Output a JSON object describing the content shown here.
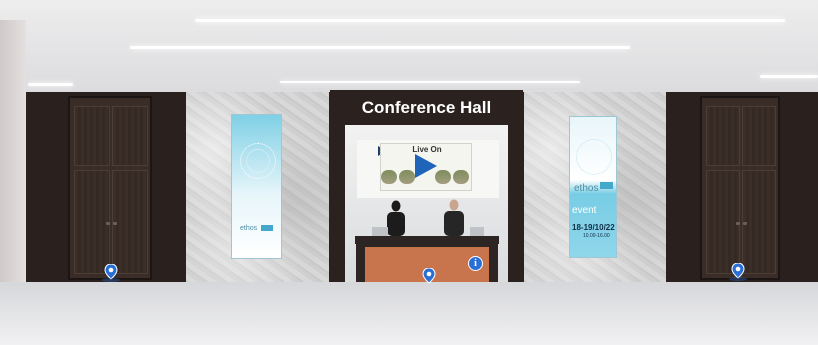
{
  "hall": {
    "title": "Conference Hall"
  },
  "screen": {
    "logo_text": "Live On"
  },
  "posters": {
    "left": {
      "brand": "ethos"
    },
    "right": {
      "brand": "ethos",
      "event_label": "event",
      "dates": "18-19/10/22",
      "time": "10.00-16.00"
    }
  },
  "hotspots": {
    "left_door": "location-pin-icon",
    "desk": "location-pin-icon",
    "info": "i",
    "right_door": "location-pin-icon"
  },
  "colors": {
    "wall_dark": "#2a201d",
    "desk_front": "#c8744c",
    "hotspot_blue": "#2a6fd6",
    "poster_cyan": "#7fd0e6"
  }
}
